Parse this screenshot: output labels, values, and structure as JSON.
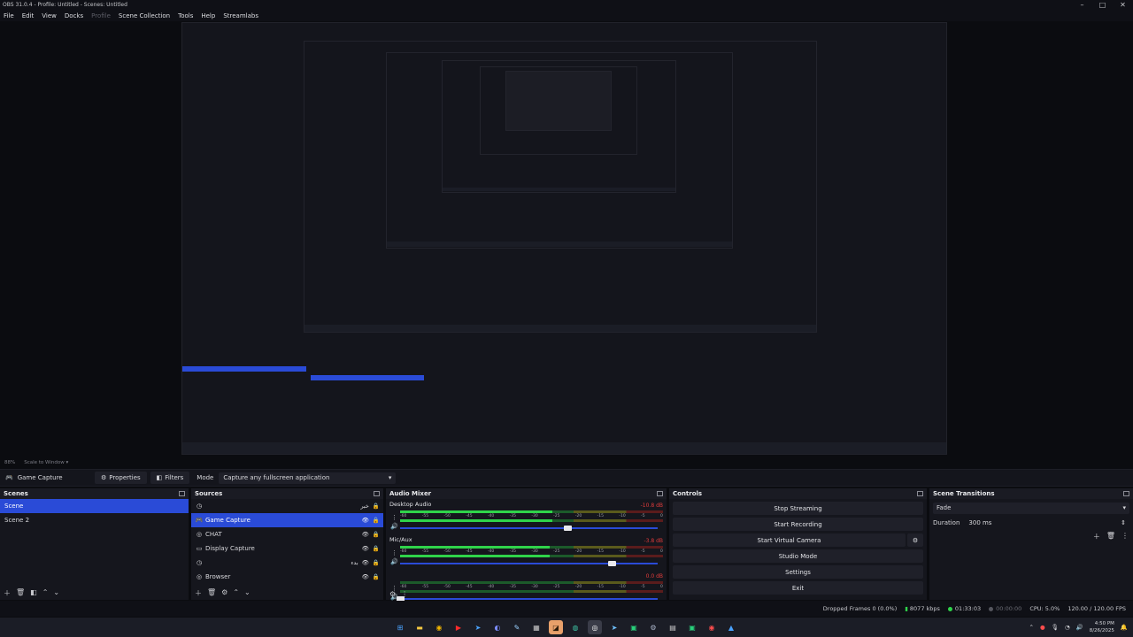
{
  "window": {
    "title": "OBS 31.0.4 - Profile: Untitled - Scenes: Untitled",
    "controls": [
      "–",
      "□",
      "✕"
    ]
  },
  "menu": {
    "items": [
      "File",
      "Edit",
      "View",
      "Docks",
      "Profile",
      "Scene Collection",
      "Tools",
      "Help",
      "Streamlabs"
    ]
  },
  "zoom": {
    "percent": "88%",
    "mode": "Scale to Window"
  },
  "properties_bar": {
    "source": "Game Capture",
    "properties_label": "Properties",
    "filters_label": "Filters",
    "mode_label": "Mode",
    "mode_value": "Capture any fullscreen application"
  },
  "scenes": {
    "title": "Scenes",
    "items": [
      "Scene",
      "Scene 2"
    ]
  },
  "sources": {
    "title": "Sources",
    "items": [
      {
        "name": "",
        "icon": "clock-icon",
        "extra": "خبر"
      },
      {
        "name": "Game Capture",
        "icon": "gamepad-icon",
        "extra": ""
      },
      {
        "name": "CHAT",
        "icon": "globe-icon",
        "extra": ""
      },
      {
        "name": "Display Capture",
        "icon": "monitor-icon",
        "extra": ""
      },
      {
        "name": "",
        "icon": "clock-icon",
        "extra": "بدء"
      },
      {
        "name": "Browser",
        "icon": "globe-icon",
        "extra": ""
      }
    ]
  },
  "mixer": {
    "title": "Audio Mixer",
    "channels": [
      {
        "name": "Desktop Audio",
        "db": "-10.8 dB",
        "level": 0.58,
        "fader": 0.65
      },
      {
        "name": "Mic/Aux",
        "db": "-3.8 dB",
        "level": 0.57,
        "fader": 0.82
      },
      {
        "name": "",
        "db": "0.0 dB",
        "level": 0.0,
        "fader": 0.0
      }
    ],
    "ticks": [
      "-60",
      "-55",
      "-50",
      "-45",
      "-40",
      "-35",
      "-30",
      "-25",
      "-20",
      "-15",
      "-10",
      "-5",
      "0"
    ]
  },
  "controls": {
    "title": "Controls",
    "buttons": [
      "Stop Streaming",
      "Start Recording",
      "Start Virtual Camera",
      "Studio Mode",
      "Settings",
      "Exit"
    ]
  },
  "transitions": {
    "title": "Scene Transitions",
    "transition": "Fade",
    "duration_label": "Duration",
    "duration_value": "300 ms"
  },
  "status": {
    "dropped": "Dropped Frames 0 (0.0%)",
    "bitrate": "8077 kbps",
    "stream_time": "01:33:03",
    "rec_time": "00:00:00",
    "cpu": "CPU: 5.0%",
    "fps": "120.00 / 120.00 FPS"
  },
  "taskbar": {
    "time": "4:50 PM",
    "date": "8/26/2025"
  },
  "colors": {
    "accent": "#2a4bd7",
    "meter_green": "#2fd44a",
    "stream_dot": "#2fd44a"
  }
}
